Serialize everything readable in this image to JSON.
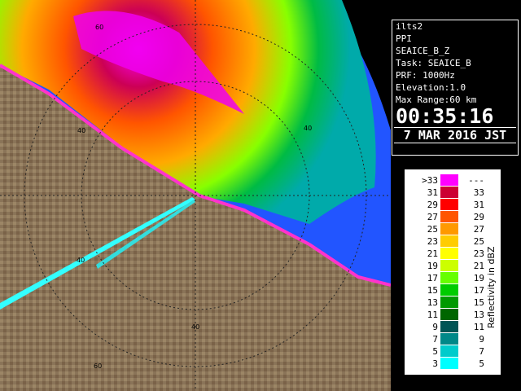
{
  "info": {
    "station": "ilts2",
    "mode": "PPI",
    "product": "SEAICE_B_Z",
    "task": "Task: SEAICE_B",
    "prf": "PRF: 1000Hz",
    "elevation": "Elevation:1.0",
    "max_range": "Max Range:60 km",
    "time": "00:35:16",
    "date": "7 MAR 2016 JST"
  },
  "legend": {
    "title": "Reflectivity in dBZ",
    "rows": [
      {
        "lo": ">33",
        "hi": "---",
        "color": "#ff00ff"
      },
      {
        "lo": "31",
        "hi": "33",
        "color": "#cc0033"
      },
      {
        "lo": "29",
        "hi": "31",
        "color": "#ff0000"
      },
      {
        "lo": "27",
        "hi": "29",
        "color": "#ff5500"
      },
      {
        "lo": "25",
        "hi": "27",
        "color": "#ff9900"
      },
      {
        "lo": "23",
        "hi": "25",
        "color": "#ffcc00"
      },
      {
        "lo": "21",
        "hi": "23",
        "color": "#ffff00"
      },
      {
        "lo": "19",
        "hi": "21",
        "color": "#ccff00"
      },
      {
        "lo": "17",
        "hi": "19",
        "color": "#66ff00"
      },
      {
        "lo": "15",
        "hi": "17",
        "color": "#00cc00"
      },
      {
        "lo": "13",
        "hi": "15",
        "color": "#009900"
      },
      {
        "lo": "11",
        "hi": "13",
        "color": "#006600"
      },
      {
        "lo": "9",
        "hi": "11",
        "color": "#005555"
      },
      {
        "lo": "7",
        "hi": "9",
        "color": "#008888"
      },
      {
        "lo": "5",
        "hi": "7",
        "color": "#00cccc"
      },
      {
        "lo": "3",
        "hi": "5",
        "color": "#00ffff"
      }
    ]
  },
  "range_labels": [
    "60",
    "40",
    "40",
    "40",
    "40",
    "60"
  ],
  "colors": {
    "sea": "#2255ff",
    "land": "#8a7458",
    "background": "#000000"
  }
}
